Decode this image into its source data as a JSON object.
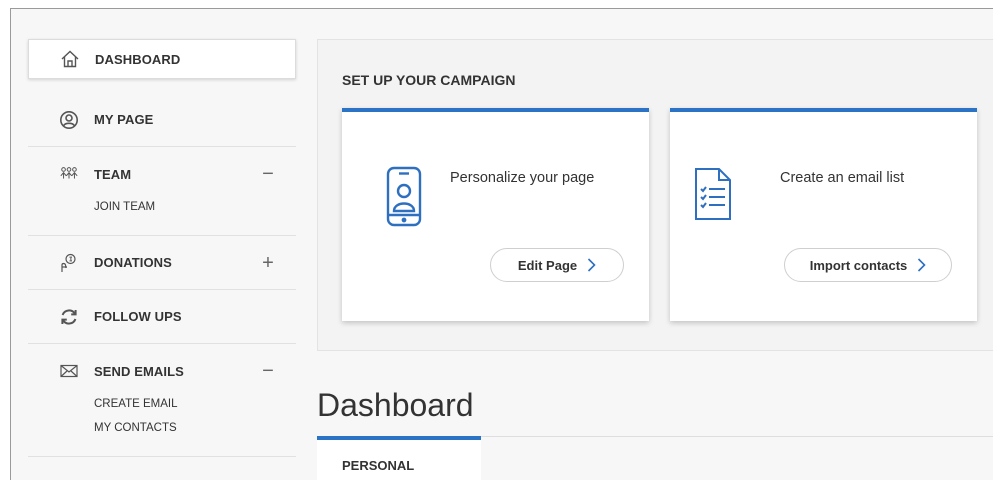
{
  "sidebar": {
    "items": [
      {
        "label": "DASHBOARD",
        "icon": "home-icon"
      },
      {
        "label": "MY PAGE",
        "icon": "user-circle-icon"
      },
      {
        "label": "TEAM",
        "icon": "team-icon",
        "toggle": "−",
        "sub": [
          "JOIN TEAM"
        ]
      },
      {
        "label": "DONATIONS",
        "icon": "donation-hand-icon",
        "toggle": "+"
      },
      {
        "label": "FOLLOW UPS",
        "icon": "refresh-icon"
      },
      {
        "label": "SEND EMAILS",
        "icon": "envelope-icon",
        "toggle": "−",
        "sub": [
          "CREATE EMAIL",
          "MY CONTACTS"
        ]
      }
    ]
  },
  "campaign": {
    "title": "SET UP YOUR CAMPAIGN",
    "cards": [
      {
        "text": "Personalize your page",
        "button": "Edit Page",
        "icon": "phone-profile-icon"
      },
      {
        "text": "Create an email list",
        "button": "Import contacts",
        "icon": "checklist-document-icon"
      }
    ]
  },
  "dashboard": {
    "title": "Dashboard",
    "tabs": [
      {
        "label": "PERSONAL"
      }
    ]
  },
  "colors": {
    "accent": "#2b73c4",
    "icon_blue": "#2e6fc0",
    "text": "#333333"
  }
}
